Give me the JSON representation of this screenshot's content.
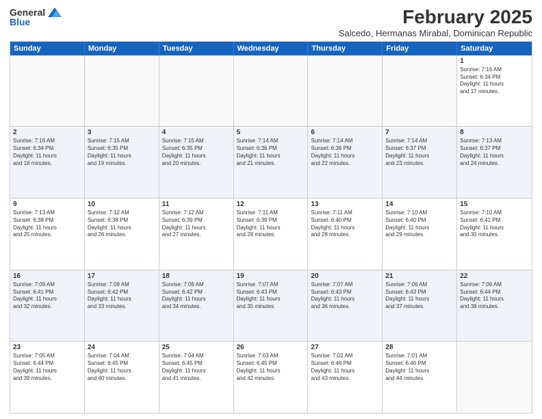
{
  "header": {
    "logo_line1": "General",
    "logo_line2": "Blue",
    "month_title": "February 2025",
    "subtitle": "Salcedo, Hermanas Mirabal, Dominican Republic"
  },
  "weekdays": [
    "Sunday",
    "Monday",
    "Tuesday",
    "Wednesday",
    "Thursday",
    "Friday",
    "Saturday"
  ],
  "weeks": [
    [
      {
        "day": "",
        "info": ""
      },
      {
        "day": "",
        "info": ""
      },
      {
        "day": "",
        "info": ""
      },
      {
        "day": "",
        "info": ""
      },
      {
        "day": "",
        "info": ""
      },
      {
        "day": "",
        "info": ""
      },
      {
        "day": "1",
        "info": "Sunrise: 7:16 AM\nSunset: 6:34 PM\nDaylight: 11 hours\nand 17 minutes."
      }
    ],
    [
      {
        "day": "2",
        "info": "Sunrise: 7:16 AM\nSunset: 6:34 PM\nDaylight: 11 hours\nand 18 minutes."
      },
      {
        "day": "3",
        "info": "Sunrise: 7:15 AM\nSunset: 6:35 PM\nDaylight: 11 hours\nand 19 minutes."
      },
      {
        "day": "4",
        "info": "Sunrise: 7:15 AM\nSunset: 6:35 PM\nDaylight: 11 hours\nand 20 minutes."
      },
      {
        "day": "5",
        "info": "Sunrise: 7:14 AM\nSunset: 6:36 PM\nDaylight: 11 hours\nand 21 minutes."
      },
      {
        "day": "6",
        "info": "Sunrise: 7:14 AM\nSunset: 6:36 PM\nDaylight: 11 hours\nand 22 minutes."
      },
      {
        "day": "7",
        "info": "Sunrise: 7:14 AM\nSunset: 6:37 PM\nDaylight: 11 hours\nand 23 minutes."
      },
      {
        "day": "8",
        "info": "Sunrise: 7:13 AM\nSunset: 6:37 PM\nDaylight: 11 hours\nand 24 minutes."
      }
    ],
    [
      {
        "day": "9",
        "info": "Sunrise: 7:13 AM\nSunset: 6:38 PM\nDaylight: 11 hours\nand 25 minutes."
      },
      {
        "day": "10",
        "info": "Sunrise: 7:12 AM\nSunset: 6:38 PM\nDaylight: 11 hours\nand 26 minutes."
      },
      {
        "day": "11",
        "info": "Sunrise: 7:12 AM\nSunset: 6:39 PM\nDaylight: 11 hours\nand 27 minutes."
      },
      {
        "day": "12",
        "info": "Sunrise: 7:11 AM\nSunset: 6:39 PM\nDaylight: 11 hours\nand 28 minutes."
      },
      {
        "day": "13",
        "info": "Sunrise: 7:11 AM\nSunset: 6:40 PM\nDaylight: 11 hours\nand 28 minutes."
      },
      {
        "day": "14",
        "info": "Sunrise: 7:10 AM\nSunset: 6:40 PM\nDaylight: 11 hours\nand 29 minutes."
      },
      {
        "day": "15",
        "info": "Sunrise: 7:10 AM\nSunset: 6:41 PM\nDaylight: 11 hours\nand 30 minutes."
      }
    ],
    [
      {
        "day": "16",
        "info": "Sunrise: 7:09 AM\nSunset: 6:41 PM\nDaylight: 11 hours\nand 32 minutes."
      },
      {
        "day": "17",
        "info": "Sunrise: 7:09 AM\nSunset: 6:42 PM\nDaylight: 11 hours\nand 33 minutes."
      },
      {
        "day": "18",
        "info": "Sunrise: 7:08 AM\nSunset: 6:42 PM\nDaylight: 11 hours\nand 34 minutes."
      },
      {
        "day": "19",
        "info": "Sunrise: 7:07 AM\nSunset: 6:43 PM\nDaylight: 11 hours\nand 35 minutes."
      },
      {
        "day": "20",
        "info": "Sunrise: 7:07 AM\nSunset: 6:43 PM\nDaylight: 11 hours\nand 36 minutes."
      },
      {
        "day": "21",
        "info": "Sunrise: 7:06 AM\nSunset: 6:43 PM\nDaylight: 11 hours\nand 37 minutes."
      },
      {
        "day": "22",
        "info": "Sunrise: 7:06 AM\nSunset: 6:44 PM\nDaylight: 11 hours\nand 38 minutes."
      }
    ],
    [
      {
        "day": "23",
        "info": "Sunrise: 7:05 AM\nSunset: 6:44 PM\nDaylight: 11 hours\nand 39 minutes."
      },
      {
        "day": "24",
        "info": "Sunrise: 7:04 AM\nSunset: 6:45 PM\nDaylight: 11 hours\nand 40 minutes."
      },
      {
        "day": "25",
        "info": "Sunrise: 7:04 AM\nSunset: 6:45 PM\nDaylight: 11 hours\nand 41 minutes."
      },
      {
        "day": "26",
        "info": "Sunrise: 7:03 AM\nSunset: 6:45 PM\nDaylight: 11 hours\nand 42 minutes."
      },
      {
        "day": "27",
        "info": "Sunrise: 7:02 AM\nSunset: 6:46 PM\nDaylight: 11 hours\nand 43 minutes."
      },
      {
        "day": "28",
        "info": "Sunrise: 7:01 AM\nSunset: 6:46 PM\nDaylight: 11 hours\nand 44 minutes."
      },
      {
        "day": "",
        "info": ""
      }
    ]
  ]
}
